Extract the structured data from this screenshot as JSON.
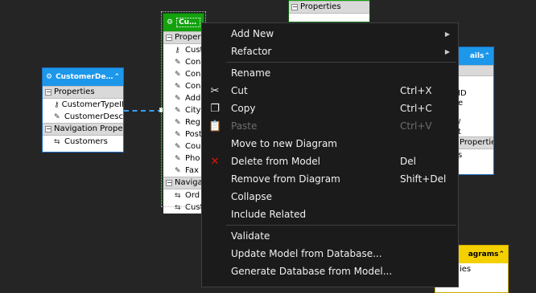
{
  "entities": {
    "customer_demo": {
      "title": "CustomerDem...",
      "properties_label": "Properties",
      "properties": [
        "CustomerTypeID",
        "CustomerDesc"
      ],
      "nav_label": "Navigation Properties",
      "nav": [
        "Customers"
      ]
    },
    "customers": {
      "title": "Customers",
      "properties_label": "Propert",
      "properties": [
        "Cust",
        "Con",
        "Con",
        "Con",
        "Add",
        "City",
        "Regi",
        "Post",
        "Cou",
        "Pho",
        "Fax"
      ],
      "nav_label": "Navigat",
      "nav": [
        "Ord",
        "Cust"
      ]
    },
    "top_mid": {
      "properties_label": "Properties"
    },
    "right_details": {
      "title": "ails",
      "rows": [
        "",
        "ID",
        "e",
        "",
        "/",
        "t"
      ],
      "nav_label": "Properties",
      "nav": [
        "s"
      ]
    },
    "bottom_right": {
      "title": "agrams",
      "rows": [
        "ies"
      ]
    }
  },
  "context_menu": {
    "items": [
      {
        "label": "Add New",
        "shortcut": "",
        "submenu": true
      },
      {
        "label": "Refactor",
        "shortcut": "",
        "submenu": true
      },
      {
        "separator": true
      },
      {
        "label": "Rename",
        "shortcut": ""
      },
      {
        "label": "Cut",
        "shortcut": "Ctrl+X",
        "icon": "cut-icon"
      },
      {
        "label": "Copy",
        "shortcut": "Ctrl+C",
        "icon": "copy-icon"
      },
      {
        "label": "Paste",
        "shortcut": "Ctrl+V",
        "icon": "paste-icon",
        "disabled": true
      },
      {
        "label": "Move to new Diagram",
        "shortcut": ""
      },
      {
        "label": "Delete from Model",
        "shortcut": "Del",
        "icon": "delete-icon"
      },
      {
        "label": "Remove from Diagram",
        "shortcut": "Shift+Del"
      },
      {
        "label": "Collapse",
        "shortcut": ""
      },
      {
        "label": "Include Related",
        "shortcut": ""
      },
      {
        "separator": true
      },
      {
        "label": "Validate",
        "shortcut": ""
      },
      {
        "label": "Update Model from Database...",
        "shortcut": ""
      },
      {
        "label": "Generate Database from Model...",
        "shortcut": ""
      }
    ]
  },
  "colors": {
    "canvas": "#252526",
    "entity_blue": "#1c97ea",
    "entity_green": "#13a10e",
    "entity_yellow": "#f5d000",
    "delete_red": "#e51400"
  }
}
